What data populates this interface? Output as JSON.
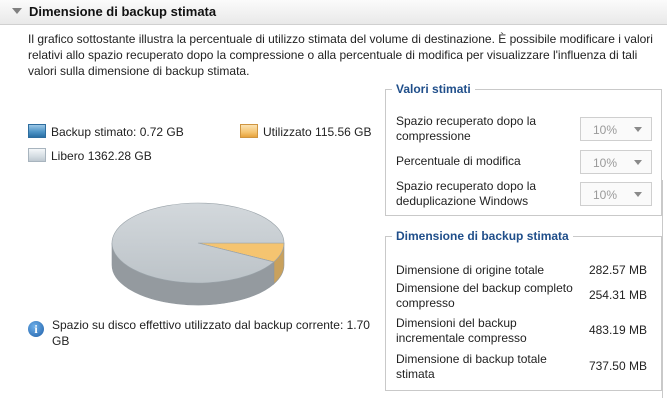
{
  "header": {
    "title": "Dimensione di backup stimata"
  },
  "description": "Il grafico sottostante illustra la percentuale di utilizzo stimata del volume di destinazione. È possibile modificare i valori relativi allo spazio recuperato dopo la compressione o alla percentuale di modifica per visualizzare l'influenza di tali valori sulla dimensione di backup stimata.",
  "legend": {
    "backup": {
      "label": "Backup stimato:",
      "value": "0.72 GB"
    },
    "used": {
      "label": "Utilizzato",
      "value": "115.56 GB"
    },
    "free": {
      "label": "Libero",
      "value": "1362.28 GB"
    }
  },
  "chart_data": {
    "type": "pie",
    "slices": [
      {
        "name": "Backup stimato",
        "value": 0.72,
        "color": "#4f95c7"
      },
      {
        "name": "Utilizzato",
        "value": 115.56,
        "color": "#f5c470"
      },
      {
        "name": "Libero",
        "value": 1362.28,
        "color": "#c9d1d6"
      }
    ]
  },
  "info": {
    "text": "Spazio su disco effettivo utilizzato dal backup corrente:  1.70 GB"
  },
  "valori_stimati": {
    "title": "Valori stimati",
    "rows": [
      {
        "label": "Spazio recuperato dopo la compressione",
        "value": "10%"
      },
      {
        "label": "Percentuale di modifica",
        "value": "10%"
      },
      {
        "label": "Spazio recuperato dopo la deduplicazione Windows",
        "value": "10%"
      }
    ]
  },
  "dimensione": {
    "title": "Dimensione di backup stimata",
    "rows": [
      {
        "label": "Dimensione di origine totale",
        "value": "282.57 MB"
      },
      {
        "label": "Dimensione del backup completo compresso",
        "value": "254.31 MB"
      },
      {
        "label": "Dimensioni del backup incrementale compresso",
        "value": "483.19 MB"
      },
      {
        "label": "Dimensione di backup totale stimata",
        "value": "737.50 MB"
      }
    ]
  },
  "colors": {
    "accent": "#1f4e8a"
  }
}
